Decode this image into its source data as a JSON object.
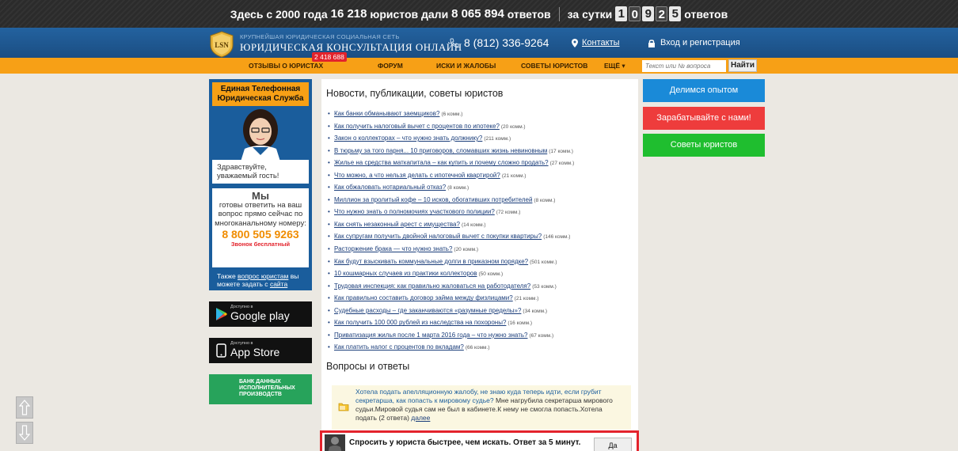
{
  "topbar": {
    "prefix": "Здесь с 2000 года",
    "lawyers": "16 218",
    "mid": "юристов дали",
    "answers": "8 065 894",
    "answers_suffix": "ответов",
    "day_prefix": "за сутки",
    "day_digits": [
      "1",
      "0",
      "9",
      "2",
      "5"
    ],
    "day_suffix": "ответов"
  },
  "header": {
    "logo_text": "LSN",
    "brand_sub": "КРУПНЕЙШАЯ ЮРИДИЧЕСКАЯ СОЦИАЛЬНАЯ СЕТЬ",
    "brand_main": "ЮРИДИЧЕСКАЯ КОНСУЛЬТАЦИЯ ОНЛАЙН",
    "phone": "8 (812) 336-9264",
    "contacts": "Контакты",
    "login": "Вход и регистрация"
  },
  "nav": {
    "reviews": "ОТЗЫВЫ О ЮРИСТАХ",
    "reviews_badge": "2 418 688",
    "forum": "ФОРУМ",
    "claims": "ИСКИ И ЖАЛОБЫ",
    "advice": "СОВЕТЫ ЮРИСТОВ",
    "more": "ЕЩЁ ▾",
    "search_placeholder": "Текст или № вопроса",
    "search_button": "Найти"
  },
  "phonecard": {
    "head": "Единая Телефонная Юридическая Служба",
    "greeting": "Здравствуйте, уважаемый гость!",
    "we": "Мы",
    "desc": "готовы ответить на ваш вопрос прямо сейчас по многоканальному номеру:",
    "number": "8 800 505 9263",
    "free": "Звонок бесплатный",
    "also_pre": "Также",
    "also_link": "вопрос юристам",
    "also_mid": "вы можете задать с",
    "also_site": "сайта"
  },
  "stores": {
    "google_small": "Доступно в",
    "google_name": "Google play",
    "apple_small": "Доступно в",
    "apple_name": "App Store",
    "bank": "БАНК ДАННЫХ ИСПОЛНИТЕЛЬНЫХ ПРОИЗВОДСТВ"
  },
  "content": {
    "news_title": "Новости, публикации, советы юристов",
    "news": [
      {
        "title": "Как банки обманывают заемщиков?",
        "comments": "(6 комм.)"
      },
      {
        "title": "Как получить налоговый вычет с процентов по ипотеке?",
        "comments": "(20 комм.)"
      },
      {
        "title": "Закон о коллекторах – что нужно знать должнику?",
        "comments": "(211 комм.)"
      },
      {
        "title": "В тюрьму за того парня... 10 приговоров, сломавших жизнь невиновным",
        "comments": "(17 комм.)"
      },
      {
        "title": "Жилье на средства маткапитала – как купить и почему сложно продать?",
        "comments": "(27 комм.)"
      },
      {
        "title": "Что можно, а что нельзя делать с ипотечной квартирой?",
        "comments": "(21 комм.)"
      },
      {
        "title": "Как обжаловать нотариальный отказ?",
        "comments": "(8 комм.)"
      },
      {
        "title": "Миллион за пролитый кофе – 10 исков, обогативших потребителей",
        "comments": "(8 комм.)"
      },
      {
        "title": "Что нужно знать о полномочиях участкового полиции?",
        "comments": "(72 комм.)"
      },
      {
        "title": "Как снять незаконный арест с имущества?",
        "comments": "(14 комм.)"
      },
      {
        "title": "Как супругам получить двойной налоговый вычет с покупки квартиры?",
        "comments": "(146 комм.)"
      },
      {
        "title": "Расторжение брака — что нужно знать?",
        "comments": "(20 комм.)"
      },
      {
        "title": "Как будут взыскивать коммунальные долги в приказном порядке?",
        "comments": "(501 комм.)"
      },
      {
        "title": "10 кошмарных случаев из практики коллекторов",
        "comments": "(50 комм.)"
      },
      {
        "title": "Трудовая инспекция: как правильно жаловаться на работодателя?",
        "comments": "(53 комм.)"
      },
      {
        "title": "Как правильно составить договор займа между физлицами?",
        "comments": "(21 комм.)"
      },
      {
        "title": "Судебные расходы – где заканчиваются «разумные пределы»?",
        "comments": "(34 комм.)"
      },
      {
        "title": "Как получить 100 000 рублей из наследства на похороны?",
        "comments": "(16 комм.)"
      },
      {
        "title": "Приватизация жилья после 1 марта 2016 года – что нужно знать?",
        "comments": "(67 комм.)"
      },
      {
        "title": "Как платить налог с процентов по вкладам?",
        "comments": "(66 комм.)"
      }
    ],
    "qa_title": "Вопросы и ответы",
    "qa_question": "Хотела подать апелляционную жалобу, не знаю куда теперь идти, если грубит секретарша, как попасть к мировому судье?",
    "qa_body": "Мне нагрубила секретарша мирового судьи.Мировой судья сам не был в кабинете.К нему не смогла попасть.Хотела подать (2 ответа)",
    "qa_more": "далее"
  },
  "askbar": {
    "text": "Спросить у юриста быстрее, чем искать. Ответ за 5 минут.",
    "yes": "Да"
  },
  "right": {
    "share": "Делимся опытом",
    "earn": "Зарабатывайте с нами!",
    "tips": "Советы юристов"
  },
  "colors": {
    "topbar": "#2b2b2b",
    "header_blue": "#1f5891",
    "nav_orange": "#f7a016",
    "share_blue": "#1a8ad8",
    "earn_red": "#ee3c3c",
    "tips_green": "#1fbe2f",
    "bank_green": "#27a35b"
  }
}
